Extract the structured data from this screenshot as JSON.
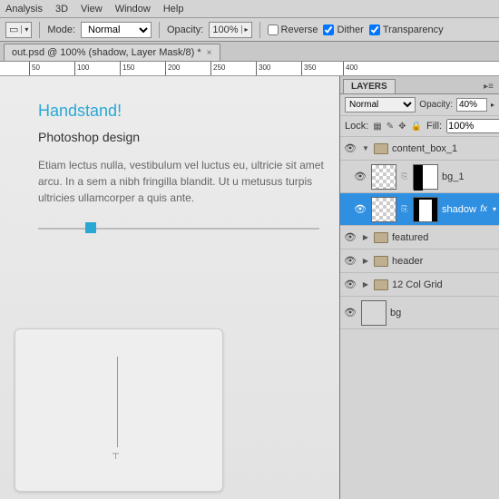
{
  "menubar": [
    "Analysis",
    "3D",
    "View",
    "Window",
    "Help"
  ],
  "options": {
    "mode_label": "Mode:",
    "mode_value": "Normal",
    "opacity_label": "Opacity:",
    "opacity_value": "100%",
    "reverse": "Reverse",
    "dither": "Dither",
    "transparency": "Transparency"
  },
  "doc_tab": "out.psd @ 100% (shadow, Layer Mask/8) *",
  "ruler": [
    "50",
    "100",
    "150",
    "200",
    "250",
    "300",
    "350",
    "400"
  ],
  "canvas": {
    "title": "Handstand!",
    "subtitle": "Photoshop design",
    "body": "Etiam lectus nulla, vestibulum vel luctus eu, ultricie sit amet arcu. In a sem a nibh fringilla blandit. Ut u metusus turpis ultricies ullamcorper a quis ante."
  },
  "panel": {
    "tab": "LAYERS",
    "blend": "Normal",
    "opacity_label": "Opacity:",
    "opacity_value": "40%",
    "lock": "Lock:",
    "fill_label": "Fill:",
    "fill_value": "100%"
  },
  "layers": [
    {
      "name": "content_box_1",
      "type": "group",
      "open": true
    },
    {
      "name": "bg_1",
      "type": "layer",
      "mask": true
    },
    {
      "name": "shadow",
      "type": "layer",
      "mask": true,
      "selected": true,
      "fx": true
    },
    {
      "name": "featured",
      "type": "group"
    },
    {
      "name": "header",
      "type": "group"
    },
    {
      "name": "12 Col Grid",
      "type": "group"
    },
    {
      "name": "bg",
      "type": "layer",
      "solid": true
    }
  ]
}
